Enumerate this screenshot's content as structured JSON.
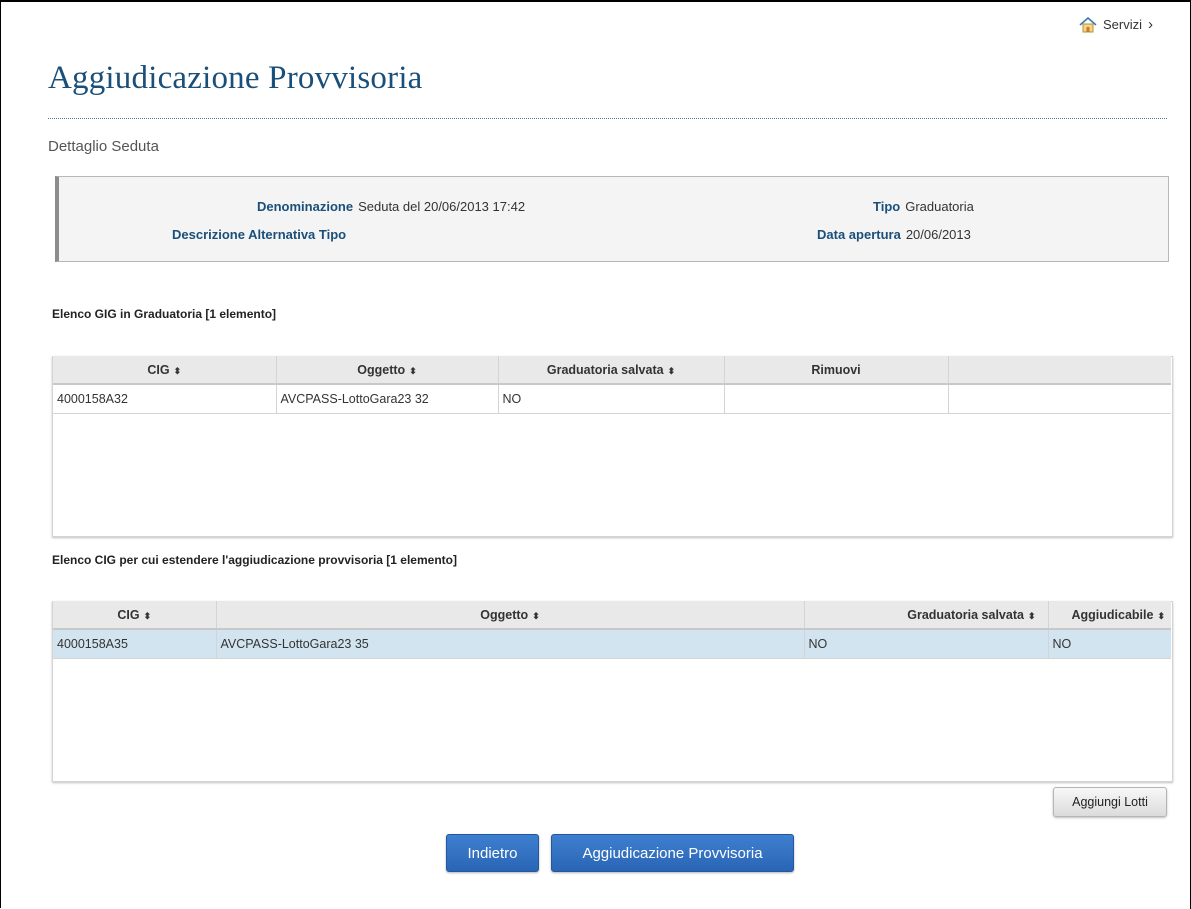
{
  "nav": {
    "servizi_label": "Servizi",
    "servizi_arrow": "›"
  },
  "page": {
    "title": "Aggiudicazione Provvisoria",
    "subtitle": "Dettaglio Seduta"
  },
  "details": {
    "denominazione_label": "Denominazione",
    "denominazione_value": "Seduta del 20/06/2013 17:42",
    "descrizione_label": "Descrizione Alternativa Tipo",
    "descrizione_value": "",
    "tipo_label": "Tipo",
    "tipo_value": "Graduatoria",
    "data_apertura_label": "Data apertura",
    "data_apertura_value": "20/06/2013"
  },
  "table1": {
    "title": "Elenco GIG in Graduatoria [1 elemento]",
    "headers": [
      "CIG",
      "Oggetto",
      "Graduatoria salvata",
      "Rimuovi",
      ""
    ],
    "rows": [
      {
        "cig": "4000158A32",
        "oggetto": "AVCPASS-LottoGara23 32",
        "graduatoria": "NO",
        "rimuovi": "",
        "extra": ""
      }
    ]
  },
  "table2": {
    "title": "Elenco CIG per cui estendere l'aggiudicazione provvisoria [1 elemento]",
    "headers": [
      "CIG",
      "Oggetto",
      "Graduatoria salvata",
      "Aggiudicabile"
    ],
    "rows": [
      {
        "cig": "4000158A35",
        "oggetto": "AVCPASS-LottoGara23 35",
        "graduatoria": "NO",
        "aggiudicabile": "NO"
      }
    ]
  },
  "sort_icon": "⬍",
  "buttons": {
    "aggiungi_lotti": "Aggiungi Lotti",
    "indietro": "Indietro",
    "aggiudicazione": "Aggiudicazione Provvisoria"
  },
  "colors": {
    "title": "#1a4f7a",
    "button_blue": "#2f6fc4",
    "selected_row": "#d2e4f0"
  }
}
